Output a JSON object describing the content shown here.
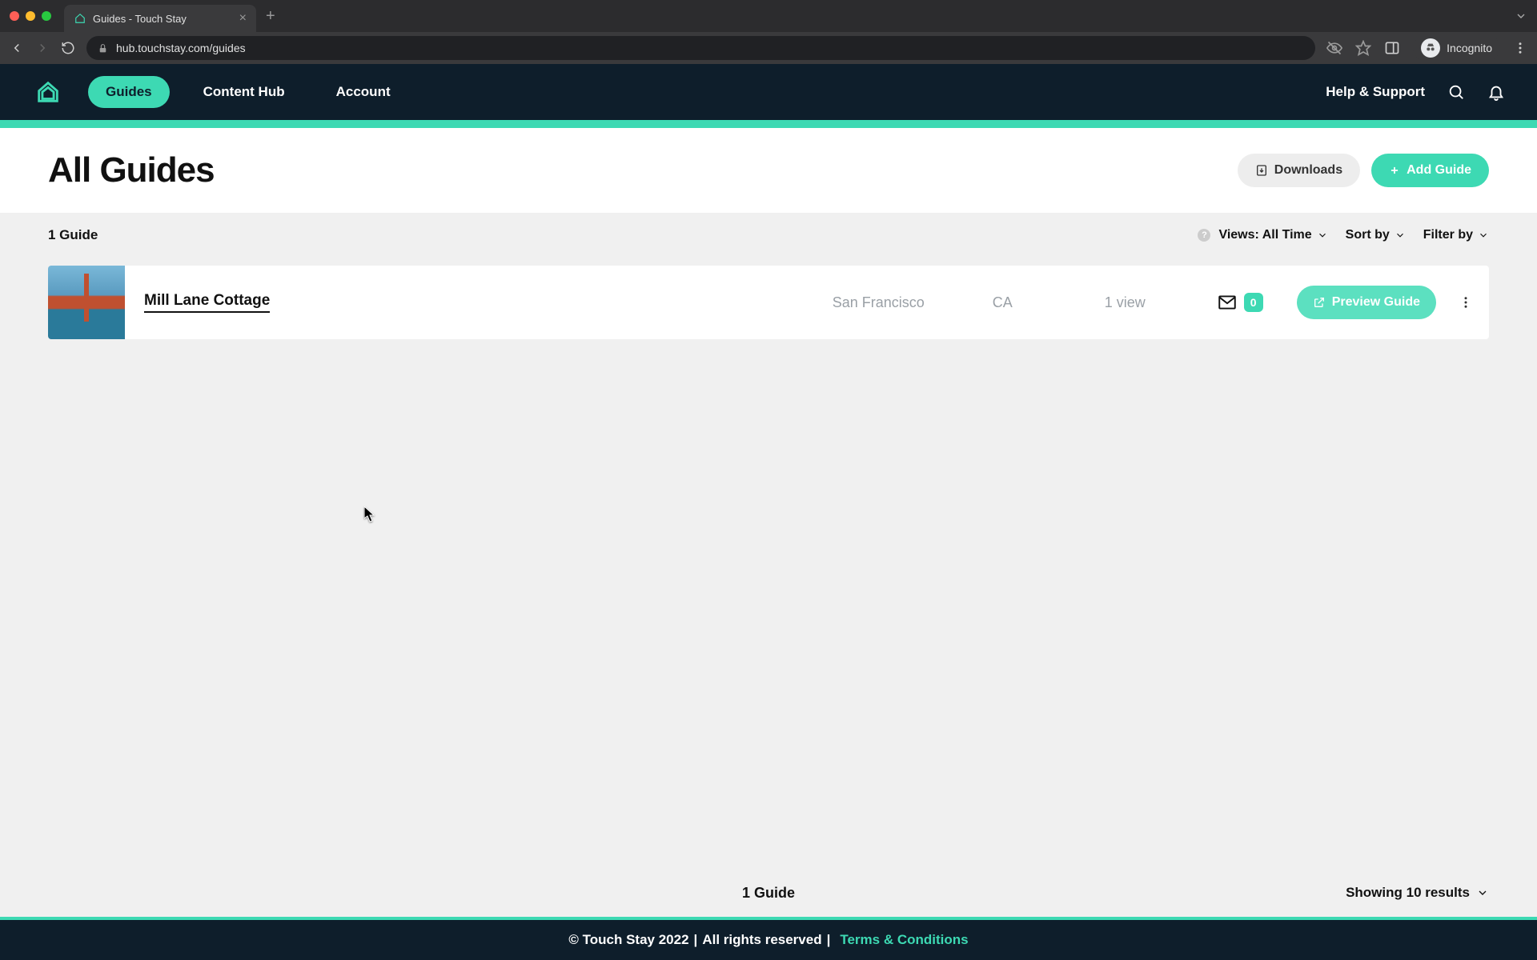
{
  "browser": {
    "tab_title": "Guides - Touch Stay",
    "url": "hub.touchstay.com/guides",
    "incognito_label": "Incognito"
  },
  "nav": {
    "items": [
      "Guides",
      "Content Hub",
      "Account"
    ],
    "active_index": 0,
    "help_label": "Help & Support"
  },
  "header": {
    "title": "All Guides",
    "downloads_label": "Downloads",
    "add_guide_label": "Add Guide"
  },
  "list_controls": {
    "count_label": "1 Guide",
    "views_label": "Views: All Time",
    "sort_label": "Sort by",
    "filter_label": "Filter by"
  },
  "guides": [
    {
      "name": "Mill Lane Cottage",
      "city": "San Francisco",
      "state": "CA",
      "views": "1 view",
      "mail_count": "0",
      "preview_label": "Preview Guide"
    }
  ],
  "list_footer": {
    "count_label": "1 Guide",
    "results_label": "Showing 10 results"
  },
  "site_footer": {
    "copyright": "© Touch Stay 2022",
    "rights": "All rights reserved",
    "terms": "Terms & Conditions"
  },
  "colors": {
    "accent": "#3dd9b3",
    "nav_bg": "#0e1e2b"
  }
}
